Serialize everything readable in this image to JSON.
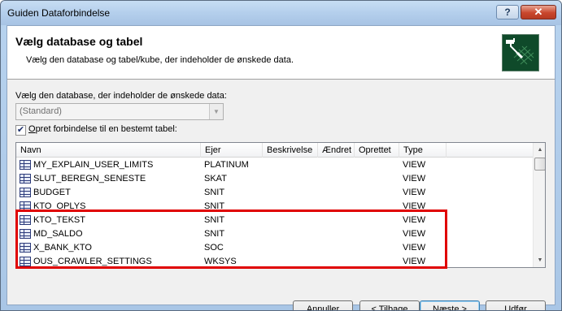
{
  "window": {
    "title": "Guiden Dataforbindelse",
    "help_label": "?",
    "close_label": "✕"
  },
  "header": {
    "title": "Vælg database og tabel",
    "subtitle": "Vælg den database og tabel/kube, der indeholder de ønskede data."
  },
  "database": {
    "label": "Vælg den database, der indeholder de ønskede data:",
    "selected": "(Standard)"
  },
  "connect_specific": {
    "checked": true,
    "label_first": "O",
    "label_rest": "pret forbindelse til en bestemt tabel:"
  },
  "table": {
    "columns": [
      "Navn",
      "Ejer",
      "Beskrivelse",
      "Ændret",
      "Oprettet",
      "Type"
    ],
    "rows": [
      {
        "name": "MY_EXPLAIN_USER_LIMITS",
        "owner": "PLATINUM",
        "type": "VIEW"
      },
      {
        "name": "SLUT_BEREGN_SENESTE",
        "owner": "SKAT",
        "type": "VIEW"
      },
      {
        "name": "BUDGET",
        "owner": "SNIT",
        "type": "VIEW"
      },
      {
        "name": "KTO_OPLYS",
        "owner": "SNIT",
        "type": "VIEW"
      },
      {
        "name": "KTO_TEKST",
        "owner": "SNIT",
        "type": "VIEW"
      },
      {
        "name": "MD_SALDO",
        "owner": "SNIT",
        "type": "VIEW"
      },
      {
        "name": "X_BANK_KTO",
        "owner": "SOC",
        "type": "VIEW"
      },
      {
        "name": "OUS_CRAWLER_SETTINGS",
        "owner": "WKSYS",
        "type": "VIEW"
      }
    ]
  },
  "buttons": {
    "cancel": "Annuller",
    "back_prefix": "< ",
    "back_underlined": "T",
    "back_rest": "ilbage",
    "next_underlined": "N",
    "next_rest": "æste >",
    "finish_underlined": "U",
    "finish_rest": "dfør"
  },
  "colors": {
    "highlight": "#e00000",
    "title_bar": "#b4cfec",
    "dialog_bg": "#f0f0f0"
  }
}
